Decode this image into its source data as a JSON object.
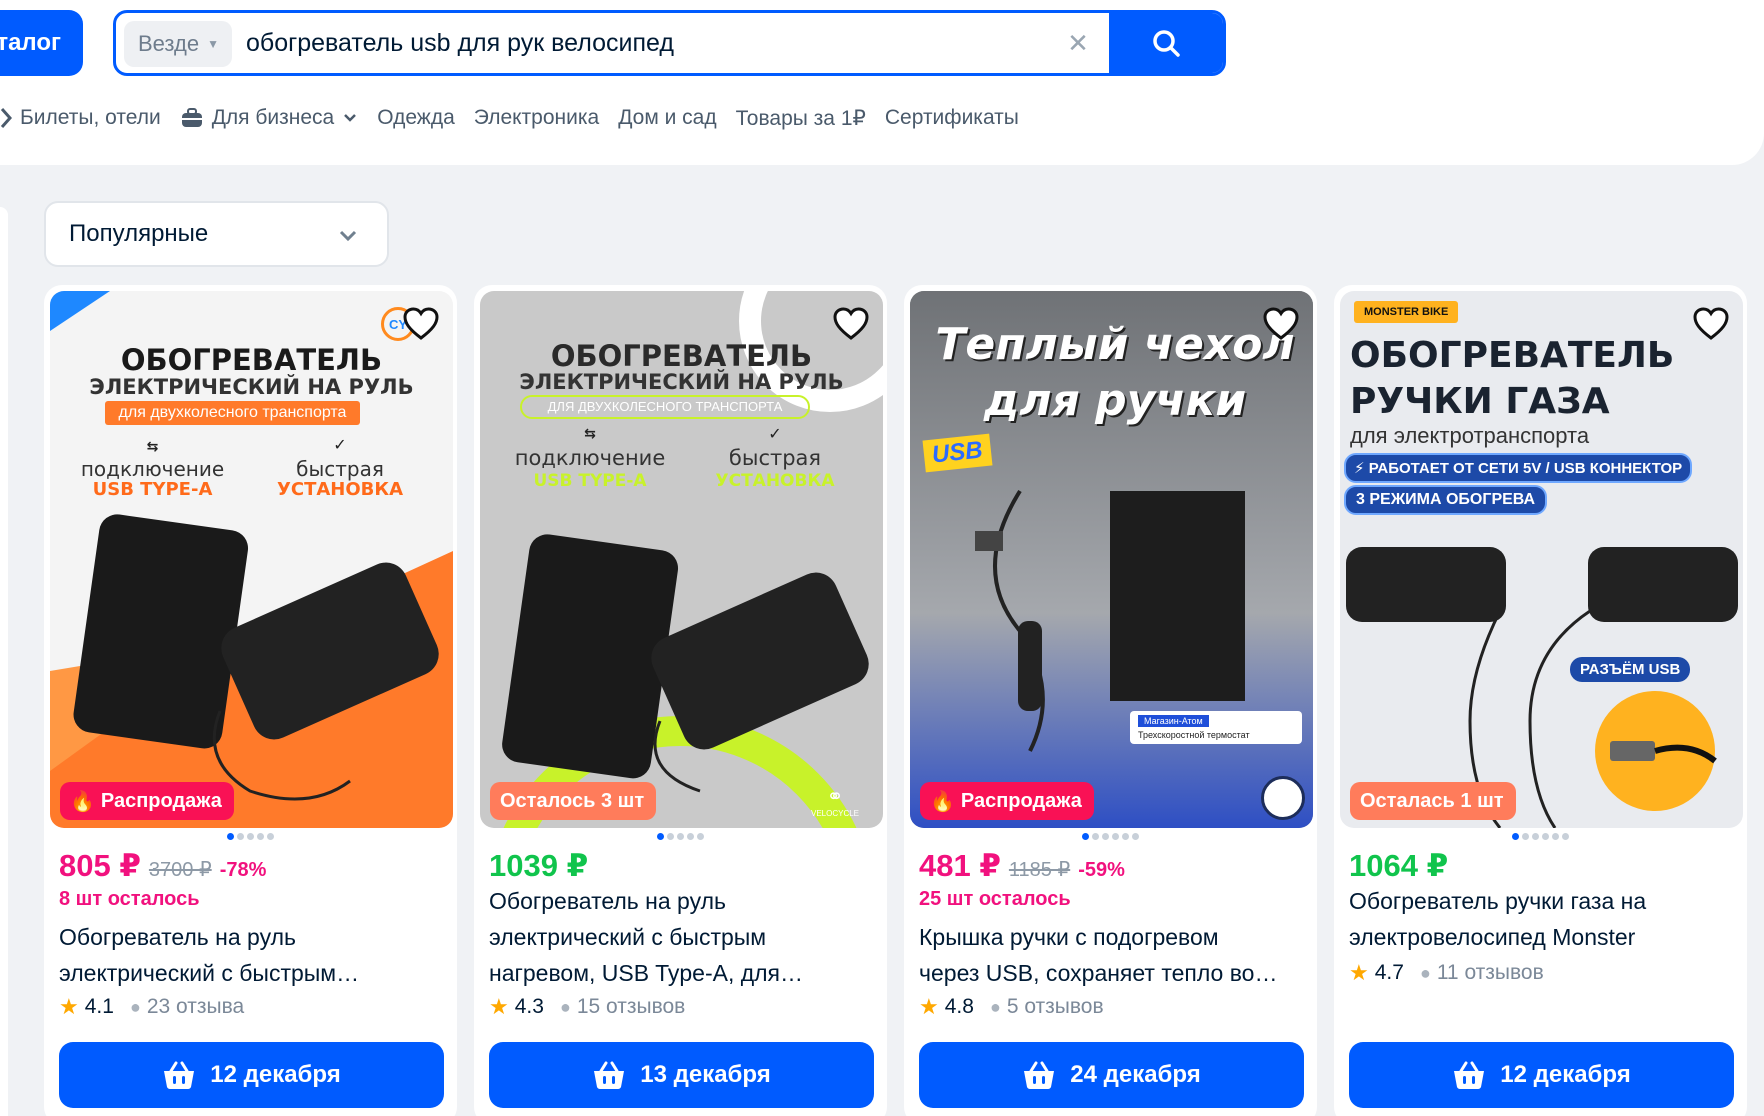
{
  "header": {
    "catalog_label": "талог",
    "search": {
      "scope": "Везде",
      "query": "обогреватель usb для рук велосипед"
    },
    "nav": [
      {
        "label": "Билеты, отели"
      },
      {
        "label": "Для бизнеса"
      },
      {
        "label": "Одежда"
      },
      {
        "label": "Электроника"
      },
      {
        "label": "Дом и сад"
      },
      {
        "label": "Товары за 1₽"
      },
      {
        "label": "Сертификаты"
      }
    ]
  },
  "sort": {
    "selected": "Популярные"
  },
  "colors": {
    "brand": "#005bff",
    "sale": "#f1117e",
    "green": "#10c44c",
    "badge_sale": "#f91155",
    "badge_left": "#ff7c5b"
  },
  "products": [
    {
      "image": {
        "headline": "ОБОГРЕВАТЕЛЬ",
        "subhead": "ЭЛЕКТРИЧЕСКИЙ НА РУЛЬ",
        "ribbon": "для двухколесного транспорта",
        "feature1_line1": "подключение",
        "feature1_line2": "USB TYPE-A",
        "feature2_line1": "быстрая",
        "feature2_line2": "УСТАНОВКА",
        "logo": "CY"
      },
      "badge": "Распродажа",
      "price": "805 ₽",
      "old_price": "3700 ₽",
      "discount": "-78%",
      "stock": "8 шт осталось",
      "title_line1": "Обогреватель на руль",
      "title_line2": "электрический с быстрым…",
      "rating": "4.1",
      "reviews": "23 отзыва",
      "delivery": "12 декабря"
    },
    {
      "image": {
        "headline": "ОБОГРЕВАТЕЛЬ",
        "subhead": "ЭЛЕКТРИЧЕСКИЙ НА РУЛЬ",
        "ribbon": "ДЛЯ ДВУХКОЛЕСНОГО ТРАНСПОРТА",
        "feature1_line1": "подключение",
        "feature1_line2": "USB TYPE-A",
        "feature2_line1": "быстрая",
        "feature2_line2": "УСТАНОВКА",
        "logo": "VELOCYCLE"
      },
      "badge": "Осталось 3 шт",
      "price": "1039 ₽",
      "title_line1": "Обогреватель на руль",
      "title_line2": "электрический с быстрым",
      "title_line3": "нагревом, USB Type-A, для…",
      "rating": "4.3",
      "reviews": "15 отзывов",
      "delivery": "13 декабря"
    },
    {
      "image": {
        "headline_line1": "Теплый чехол",
        "headline_line2": "для ручки",
        "usb": "USB",
        "shop": "Магазин-Атом",
        "thermostat": "Трехскоростной термостат"
      },
      "badge": "Распродажа",
      "price": "481 ₽",
      "old_price": "1185 ₽",
      "discount": "-59%",
      "stock": "25 шт осталось",
      "title_line1": "Крышка ручки с подогревом",
      "title_line2": "через USB, сохраняет тепло во…",
      "rating": "4.8",
      "reviews": "5 отзывов",
      "delivery": "24 декабря"
    },
    {
      "image": {
        "brand": "MONSTER BIKE",
        "headline_line1": "ОБОГРЕВАТЕЛЬ",
        "headline_line2": "РУЧКИ ГАЗА",
        "subhead": "для электротранспорта",
        "pill1": "РАБОТАЕТ ОТ СЕТИ 5V / USB КОННЕКТОР",
        "pill2": "3 РЕЖИМА ОБОГРЕВА",
        "usb_label": "РАЗЪЁМ USB"
      },
      "badge": "Осталась 1 шт",
      "price": "1064 ₽",
      "title_line1": "Обогреватель ручки газа на",
      "title_line2": "электровелосипед Monster",
      "rating": "4.7",
      "reviews": "11 отзывов",
      "delivery": "12 декабря"
    }
  ]
}
